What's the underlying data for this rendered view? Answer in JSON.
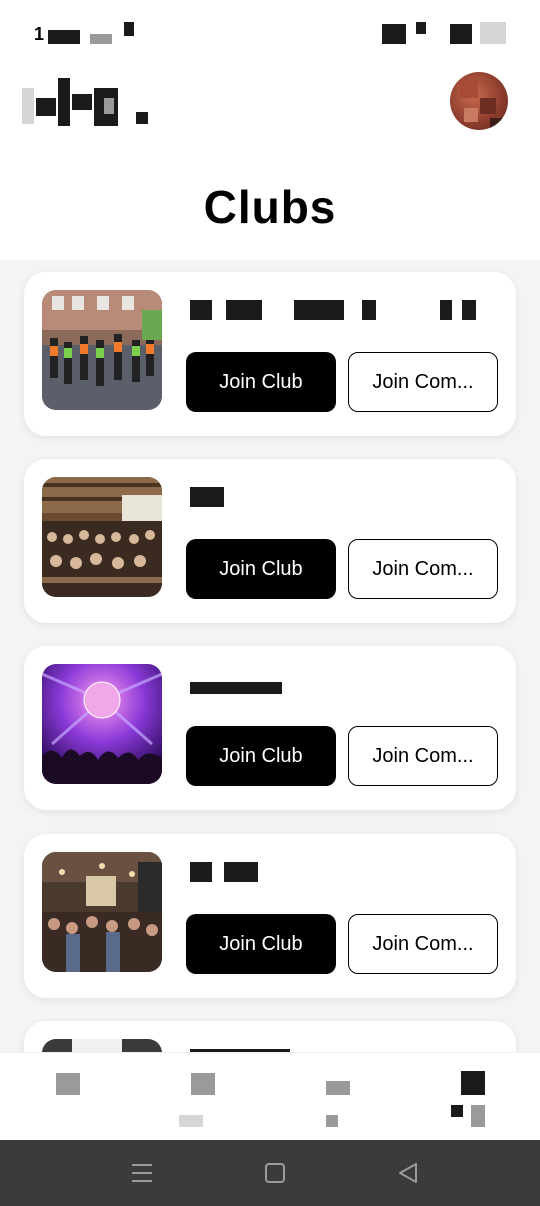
{
  "status_bar": {
    "time": "1"
  },
  "page": {
    "title": "Clubs"
  },
  "clubs": [
    {
      "name": "",
      "join_label": "Join Club",
      "community_label": "Join Com..."
    },
    {
      "name": "",
      "join_label": "Join Club",
      "community_label": "Join Com..."
    },
    {
      "name": "",
      "join_label": "Join Club",
      "community_label": "Join Com..."
    },
    {
      "name": "",
      "join_label": "Join Club",
      "community_label": "Join Com..."
    },
    {
      "name": ""
    }
  ],
  "bottom_nav": {
    "items": [
      {
        "label": "",
        "icon": "home-icon"
      },
      {
        "label": "",
        "icon": "nav-icon"
      },
      {
        "label": "",
        "icon": "nav-icon"
      },
      {
        "label": "",
        "icon": "clubs-icon",
        "active": true
      }
    ]
  },
  "system_nav": {
    "icons": [
      "menu-icon",
      "home-square-icon",
      "back-triangle-icon"
    ]
  },
  "colors": {
    "primary": "#000000",
    "background": "#f4f4f6",
    "card": "#ffffff"
  }
}
